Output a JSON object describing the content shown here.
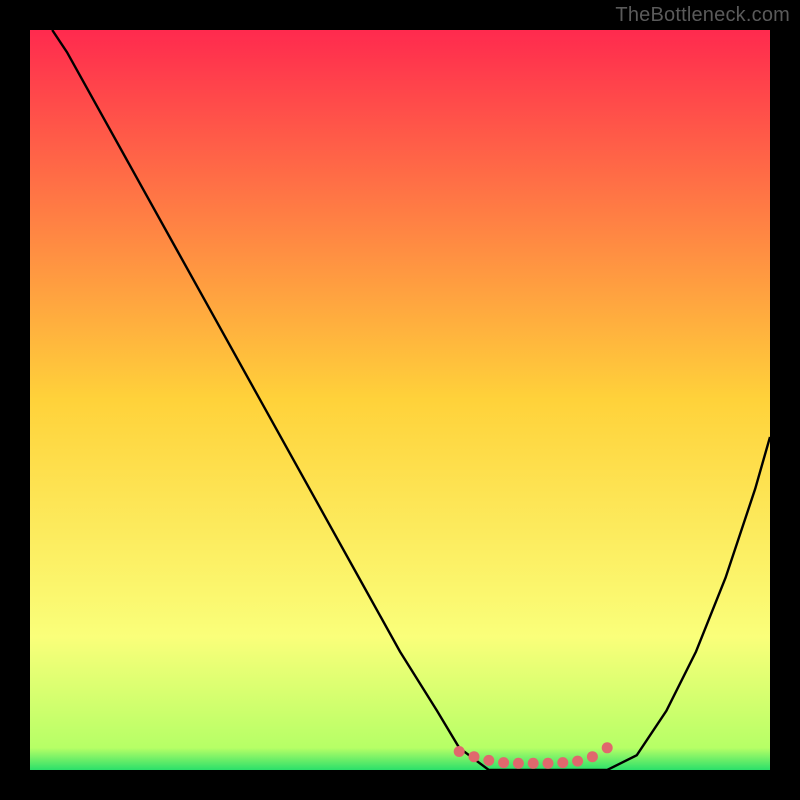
{
  "watermark": "TheBottleneck.com",
  "colors": {
    "frame": "#000000",
    "grad_top": "#ff2a4e",
    "grad_mid": "#ffd23a",
    "grad_low": "#faff7a",
    "grad_bottom": "#2be06a",
    "curve": "#000000",
    "dots": "#e0686d"
  },
  "chart_data": {
    "type": "line",
    "title": "",
    "xlabel": "",
    "ylabel": "",
    "xlim": [
      0,
      100
    ],
    "ylim": [
      0,
      100
    ],
    "series": [
      {
        "name": "bottleneck-curve",
        "x": [
          3,
          5,
          10,
          15,
          20,
          25,
          30,
          35,
          40,
          45,
          50,
          55,
          58,
          62,
          66,
          70,
          74,
          78,
          82,
          86,
          90,
          94,
          98,
          100
        ],
        "y": [
          100,
          97,
          88,
          79,
          70,
          61,
          52,
          43,
          34,
          25,
          16,
          8,
          3,
          0,
          0,
          0,
          0,
          0,
          2,
          8,
          16,
          26,
          38,
          45
        ]
      }
    ],
    "highlight": {
      "name": "optimal-range-dots",
      "x": [
        58,
        60,
        62,
        64,
        66,
        68,
        70,
        72,
        74,
        76,
        78
      ],
      "y": [
        2.5,
        1.8,
        1.3,
        1.0,
        0.9,
        0.9,
        0.9,
        1.0,
        1.2,
        1.8,
        3.0
      ]
    },
    "gradient_stops": [
      {
        "pos": 0.0,
        "color": "#ff2a4e"
      },
      {
        "pos": 0.5,
        "color": "#ffd23a"
      },
      {
        "pos": 0.82,
        "color": "#faff7a"
      },
      {
        "pos": 0.97,
        "color": "#b6ff66"
      },
      {
        "pos": 1.0,
        "color": "#2be06a"
      }
    ]
  }
}
